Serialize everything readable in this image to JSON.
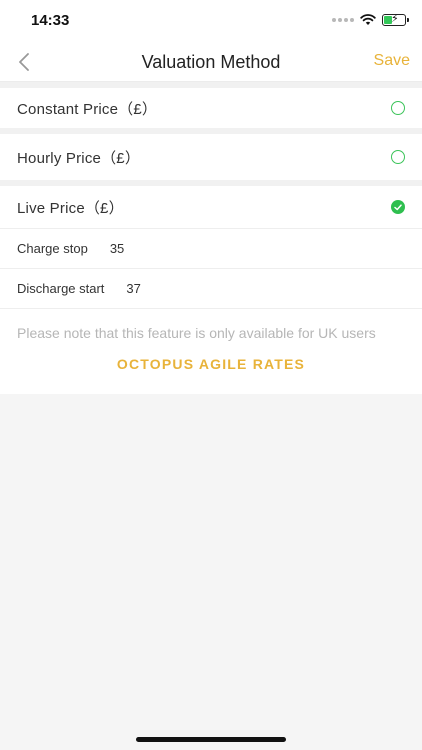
{
  "status": {
    "time": "14:33"
  },
  "nav": {
    "title": "Valuation Method",
    "save_label": "Save"
  },
  "options": [
    {
      "label": "Constant Price（£）",
      "selected": false
    },
    {
      "label": "Hourly Price（£）",
      "selected": false
    },
    {
      "label": "Live Price（£）",
      "selected": true
    }
  ],
  "live_settings": {
    "charge_stop_label": "Charge stop",
    "charge_stop_value": "35",
    "discharge_start_label": "Discharge start",
    "discharge_start_value": "37"
  },
  "note": "Please note that this feature is only available for UK users",
  "agile_link": "OCTOPUS AGILE RATES",
  "colors": {
    "accent": "#e8b33a",
    "radio": "#2fbf4f"
  },
  "icons": {
    "back": "chevron-left-icon",
    "wifi": "wifi-icon",
    "battery": "battery-charging-icon"
  }
}
